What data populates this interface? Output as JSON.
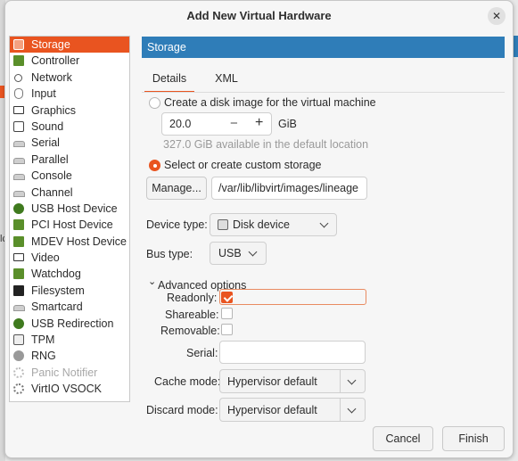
{
  "window": {
    "title": "Add New Virtual Hardware",
    "close_icon": "✕"
  },
  "background": {
    "side_text": "lc"
  },
  "sidebar": {
    "items": [
      {
        "label": "Storage",
        "icon": "disk-icon",
        "selected": true
      },
      {
        "label": "Controller",
        "icon": "board-icon"
      },
      {
        "label": "Network",
        "icon": "network-icon"
      },
      {
        "label": "Input",
        "icon": "mouse-icon"
      },
      {
        "label": "Graphics",
        "icon": "monitor-icon"
      },
      {
        "label": "Sound",
        "icon": "sound-icon"
      },
      {
        "label": "Serial",
        "icon": "serial-icon"
      },
      {
        "label": "Parallel",
        "icon": "serial-icon"
      },
      {
        "label": "Console",
        "icon": "serial-icon"
      },
      {
        "label": "Channel",
        "icon": "serial-icon"
      },
      {
        "label": "USB Host Device",
        "icon": "usb-icon"
      },
      {
        "label": "PCI Host Device",
        "icon": "board-icon"
      },
      {
        "label": "MDEV Host Device",
        "icon": "board-icon"
      },
      {
        "label": "Video",
        "icon": "monitor-icon"
      },
      {
        "label": "Watchdog",
        "icon": "board-icon"
      },
      {
        "label": "Filesystem",
        "icon": "chip-icon"
      },
      {
        "label": "Smartcard",
        "icon": "serial-icon"
      },
      {
        "label": "USB Redirection",
        "icon": "usb-icon"
      },
      {
        "label": "TPM",
        "icon": "tpm-icon"
      },
      {
        "label": "RNG",
        "icon": "rng-icon"
      },
      {
        "label": "Panic Notifier",
        "icon": "gear-icon",
        "disabled": true
      },
      {
        "label": "VirtIO VSOCK",
        "icon": "gear-icon"
      }
    ]
  },
  "main": {
    "header": "Storage",
    "tabs": [
      {
        "label": "Details",
        "active": true
      },
      {
        "label": "XML"
      }
    ],
    "create_disk": {
      "label": "Create a disk image for the virtual machine",
      "size_value": "20.0",
      "minus": "−",
      "plus": "+",
      "unit": "GiB",
      "available": "327.0 GiB available in the default location"
    },
    "custom_storage": {
      "label": "Select or create custom storage",
      "manage_button": "Manage...",
      "path_value": "/var/lib/libvirt/images/lineage"
    },
    "device_type": {
      "label": "Device type:",
      "value": "Disk device"
    },
    "bus_type": {
      "label": "Bus type:",
      "value": "USB"
    },
    "advanced": {
      "expander_label": "Advanced options",
      "expander_icon": "⌄",
      "readonly_label": "Readonly:",
      "readonly_checked": true,
      "shareable_label": "Shareable:",
      "shareable_checked": false,
      "removable_label": "Removable:",
      "removable_checked": false,
      "serial_label": "Serial:",
      "serial_value": "",
      "cache_label": "Cache mode:",
      "cache_value": "Hypervisor default",
      "discard_label": "Discard mode:",
      "discard_value": "Hypervisor default"
    },
    "buttons": {
      "cancel": "Cancel",
      "finish": "Finish"
    }
  },
  "colors": {
    "accent": "#e95420",
    "header_blue": "#2f7db8"
  }
}
